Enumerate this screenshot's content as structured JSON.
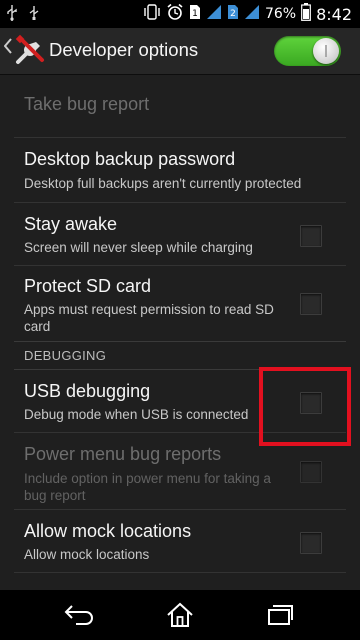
{
  "status_bar": {
    "battery_percent": "76%",
    "time": "8:42",
    "sim_badge_1": "1",
    "sim_badge_2": "2",
    "icons": [
      "usb-icon",
      "usb-debug-icon",
      "vibrate-icon",
      "alarm-icon",
      "sim1-icon",
      "signal-icon",
      "sim2-icon",
      "signal-icon",
      "battery-icon"
    ]
  },
  "action_bar": {
    "title": "Developer options",
    "master_switch_on": true
  },
  "settings": [
    {
      "title": "Take bug report",
      "summary": "",
      "enabled": false,
      "checkbox": false
    },
    {
      "title": "Desktop backup password",
      "summary": "Desktop full backups aren't currently protected",
      "enabled": true,
      "checkbox": false
    },
    {
      "title": "Stay awake",
      "summary": "Screen will never sleep while charging",
      "enabled": true,
      "checkbox": true,
      "checked": false
    },
    {
      "title": "Protect SD card",
      "summary": "Apps must request permission to read SD card",
      "enabled": true,
      "checkbox": true,
      "checked": false
    },
    {
      "section": "DEBUGGING"
    },
    {
      "title": "USB debugging",
      "summary": "Debug mode when USB is connected",
      "enabled": true,
      "checkbox": true,
      "checked": false
    },
    {
      "title": "Power menu bug reports",
      "summary": "Include option in power menu for taking a bug report",
      "enabled": false,
      "checkbox": true,
      "checked": false
    },
    {
      "title": "Allow mock locations",
      "summary": "Allow mock locations",
      "enabled": true,
      "checkbox": true,
      "checked": false
    }
  ],
  "nav_bar": {
    "icons": [
      "back-icon",
      "home-icon",
      "recent-apps-icon"
    ]
  },
  "colors": {
    "background": "#1f1f1f",
    "switch_on": "#4cc22e",
    "highlight_box": "#e2101f"
  }
}
